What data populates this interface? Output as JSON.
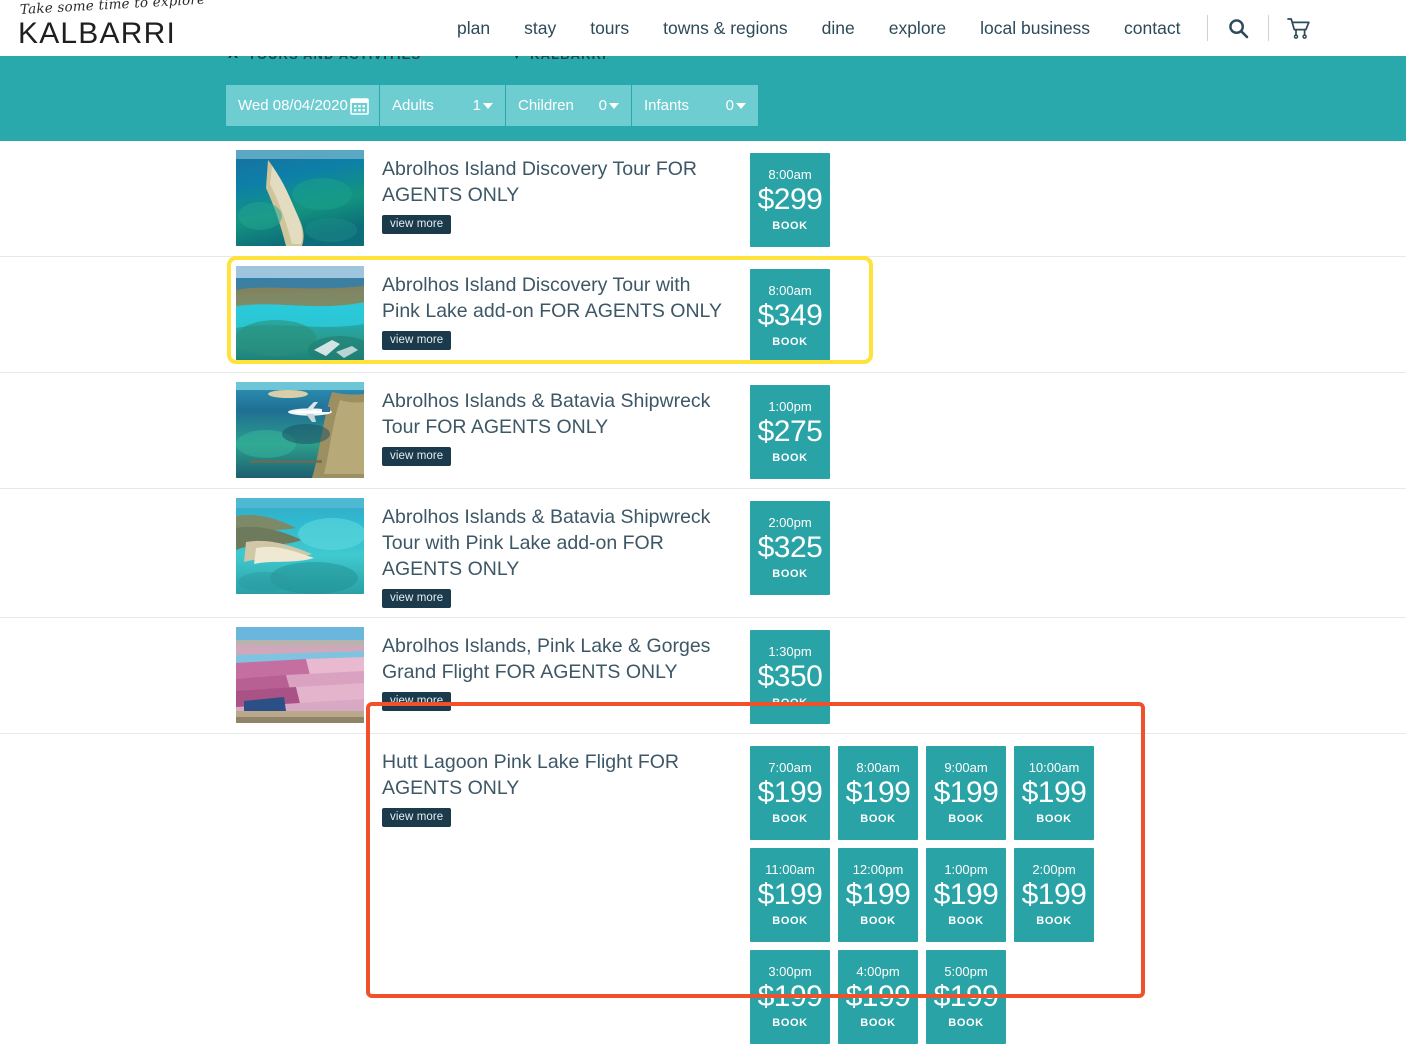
{
  "header": {
    "brand_script": "Take some time to explore",
    "brand_name": "KALBARRI",
    "nav": [
      {
        "label": "plan"
      },
      {
        "label": "stay"
      },
      {
        "label": "tours"
      },
      {
        "label": "towns & regions"
      },
      {
        "label": "dine"
      },
      {
        "label": "explore"
      },
      {
        "label": "local business"
      },
      {
        "label": "contact"
      }
    ],
    "search_icon": "search-icon",
    "cart_icon": "cart-icon"
  },
  "breadcrumb": {
    "close_label": "X",
    "category": "TOURS AND ACTIVITIES",
    "caret": "▼",
    "location": "KALBARRI"
  },
  "search_bar": {
    "background_color": "#2aa9ad",
    "field_color": "#6ecdd1",
    "date": {
      "name": "date-field",
      "value": "Wed 08/04/2020",
      "icon": "calendar-icon"
    },
    "adults": {
      "label": "Adults",
      "value": "1"
    },
    "children": {
      "label": "Children",
      "value": "0"
    },
    "infants": {
      "label": "Infants",
      "value": "0"
    }
  },
  "labels": {
    "view_more": "view more",
    "book": "BOOK"
  },
  "colors": {
    "teal_card": "#2aa3a6",
    "teal_bar": "#2aa9ad",
    "dark_button": "#1b3a4b",
    "title_text": "#3d5766",
    "highlight_yellow": "#ffe23a",
    "highlight_orange": "#f0502a"
  },
  "results": [
    {
      "title": "Abrolhos Island Discovery Tour FOR AGENTS ONLY",
      "thumb": "aerial-island-reef-photo",
      "has_thumb": true,
      "highlight": "none",
      "slots": [
        {
          "time": "8:00am",
          "price": "$299"
        }
      ]
    },
    {
      "title": "Abrolhos Island Discovery Tour with Pink Lake add-on FOR AGENTS ONLY",
      "thumb": "aerial-turquoise-reef-photo",
      "has_thumb": true,
      "highlight": "yellow",
      "slots": [
        {
          "time": "8:00am",
          "price": "$349"
        }
      ]
    },
    {
      "title": "Abrolhos Islands & Batavia Shipwreck Tour FOR AGENTS ONLY",
      "thumb": "aerial-plane-over-reef-photo",
      "has_thumb": true,
      "highlight": "none",
      "slots": [
        {
          "time": "1:00pm",
          "price": "$275"
        }
      ]
    },
    {
      "title": "Abrolhos Islands & Batavia Shipwreck Tour with Pink Lake add-on FOR AGENTS ONLY",
      "thumb": "aerial-island-sandbar-photo",
      "has_thumb": true,
      "highlight": "none",
      "slots": [
        {
          "time": "2:00pm",
          "price": "$325"
        }
      ]
    },
    {
      "title": "Abrolhos Islands, Pink Lake & Gorges Grand Flight FOR AGENTS ONLY",
      "thumb": "pink-lake-salt-ponds-photo",
      "has_thumb": true,
      "highlight": "none",
      "slots": [
        {
          "time": "1:30pm",
          "price": "$350"
        }
      ]
    },
    {
      "title": "Hutt Lagoon Pink Lake Flight FOR AGENTS ONLY",
      "thumb": "",
      "has_thumb": false,
      "highlight": "orange",
      "slots": [
        {
          "time": "7:00am",
          "price": "$199"
        },
        {
          "time": "8:00am",
          "price": "$199"
        },
        {
          "time": "9:00am",
          "price": "$199"
        },
        {
          "time": "10:00am",
          "price": "$199"
        },
        {
          "time": "11:00am",
          "price": "$199"
        },
        {
          "time": "12:00pm",
          "price": "$199"
        },
        {
          "time": "1:00pm",
          "price": "$199"
        },
        {
          "time": "2:00pm",
          "price": "$199"
        },
        {
          "time": "3:00pm",
          "price": "$199"
        },
        {
          "time": "4:00pm",
          "price": "$199"
        },
        {
          "time": "5:00pm",
          "price": "$199"
        }
      ]
    }
  ]
}
